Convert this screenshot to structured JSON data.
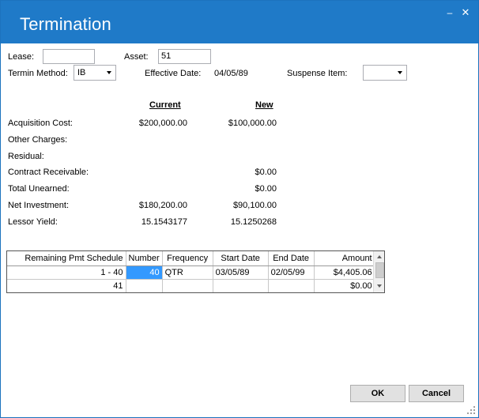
{
  "window": {
    "title": "Termination",
    "minimize_glyph": "–",
    "close_glyph": "✕"
  },
  "form": {
    "lease_label": "Lease:",
    "lease_value": "",
    "asset_label": "Asset:",
    "asset_value": "51",
    "termin_method_label": "Termin Method:",
    "termin_method_value": "IB",
    "effective_date_label": "Effective Date:",
    "effective_date_value": "04/05/89",
    "suspense_item_label": "Suspense Item:",
    "suspense_item_value": ""
  },
  "summary": {
    "current_header": "Current",
    "new_header": "New",
    "rows": [
      {
        "label": "Acquisition Cost:",
        "current": "$200,000.00",
        "new": "$100,000.00"
      },
      {
        "label": "Other Charges:",
        "current": "",
        "new": ""
      },
      {
        "label": "Residual:",
        "current": "",
        "new": ""
      },
      {
        "label": "Contract Receivable:",
        "current": "",
        "new": "$0.00"
      },
      {
        "label": "Total Unearned:",
        "current": "",
        "new": "$0.00"
      },
      {
        "label": "Net Investment:",
        "current": "$180,200.00",
        "new": "$90,100.00"
      },
      {
        "label": "Lessor Yield:",
        "current": "15.1543177",
        "new": "15.1250268"
      }
    ]
  },
  "schedule": {
    "columns": [
      "Remaining Pmt Schedule",
      "Number",
      "Frequency",
      "Start Date",
      "End Date",
      "Amount"
    ],
    "rows": [
      {
        "schedule": "1 -  40",
        "number": "40",
        "frequency": "QTR",
        "start": "03/05/89",
        "end": "02/05/99",
        "amount": "$4,405.06"
      },
      {
        "schedule": "41",
        "number": "",
        "frequency": "",
        "start": "",
        "end": "",
        "amount": "$0.00"
      }
    ]
  },
  "buttons": {
    "ok": "OK",
    "cancel": "Cancel"
  },
  "colors": {
    "titlebar": "#1f7ac8",
    "selection": "#3399ff"
  }
}
